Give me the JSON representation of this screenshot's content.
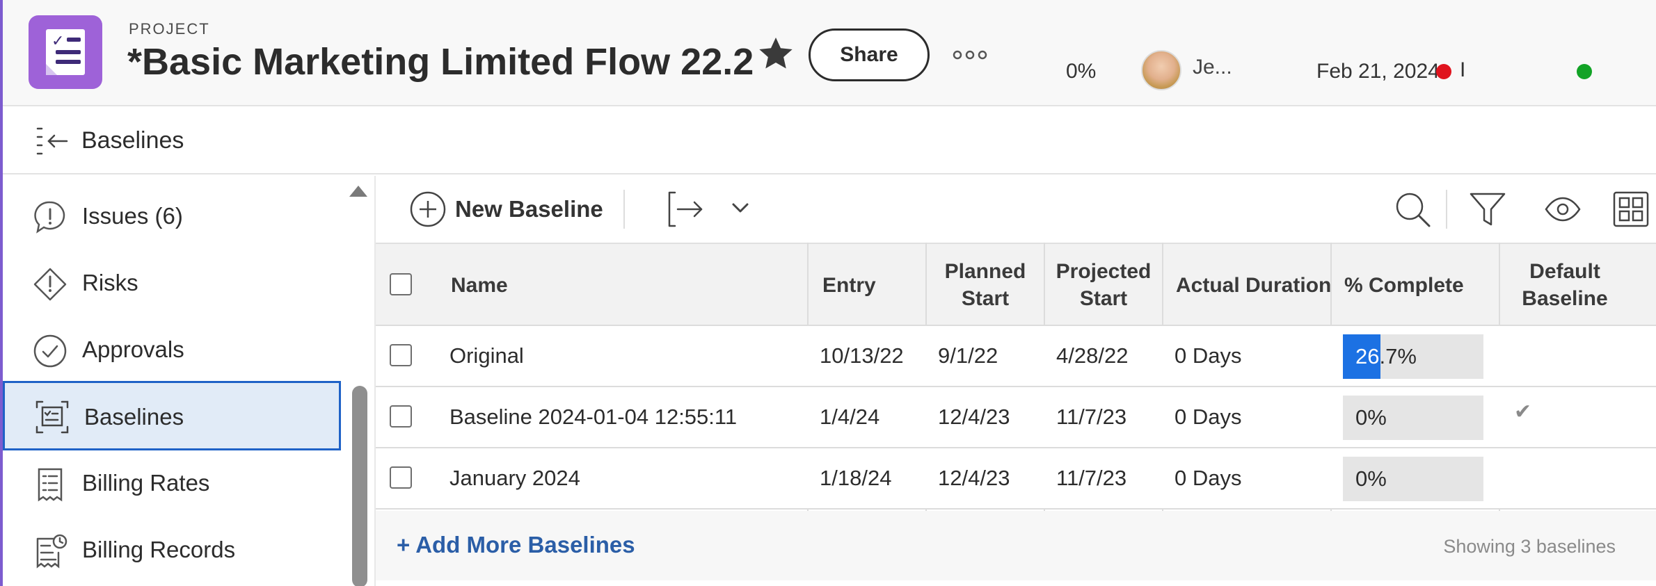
{
  "header": {
    "project_label": "PROJECT",
    "project_title": "*Basic Marketing Limited Flow 22.2",
    "share_label": "Share",
    "percent_complete": "0%",
    "owner_name": "Je...",
    "due_date": "Feb 21, 2024",
    "status_truncated": "I",
    "colors": {
      "icon_bg": "#9e62d8",
      "late_dot": "#e0141e",
      "ok_dot": "#12a326"
    }
  },
  "subheader": {
    "title": "Baselines"
  },
  "sidebar": {
    "items": [
      {
        "label": "Issues (6)",
        "icon": "issues-icon"
      },
      {
        "label": "Risks",
        "icon": "risks-icon"
      },
      {
        "label": "Approvals",
        "icon": "approvals-icon"
      },
      {
        "label": "Baselines",
        "icon": "baselines-icon",
        "active": true
      },
      {
        "label": "Billing Rates",
        "icon": "billing-rates-icon"
      },
      {
        "label": "Billing Records",
        "icon": "billing-records-icon"
      }
    ]
  },
  "toolbar": {
    "new_baseline_label": "New Baseline"
  },
  "table": {
    "columns": {
      "name": "Name",
      "entry": "Entry",
      "planned_start_1": "Planned",
      "planned_start_2": "Start",
      "projected_start_1": "Projected",
      "projected_start_2": "Start",
      "actual_duration": "Actual Duration",
      "percent_complete": "% Complete",
      "default_baseline_1": "Default",
      "default_baseline_2": "Baseline"
    },
    "rows": [
      {
        "name": "Original",
        "entry": "10/13/22",
        "planned_start": "9/1/22",
        "projected_start": "4/28/22",
        "actual_duration": "0 Days",
        "percent_complete": "26.7%",
        "percent_value": 26.7,
        "default": ""
      },
      {
        "name": "Baseline 2024-01-04 12:55:11",
        "entry": "1/4/24",
        "planned_start": "12/4/23",
        "projected_start": "11/7/23",
        "actual_duration": "0 Days",
        "percent_complete": "0%",
        "percent_value": 0,
        "default": "✔"
      },
      {
        "name": "January 2024",
        "entry": "1/18/24",
        "planned_start": "12/4/23",
        "projected_start": "11/7/23",
        "actual_duration": "0 Days",
        "percent_complete": "0%",
        "percent_value": 0,
        "default": ""
      }
    ],
    "add_more_label": "+ Add More Baselines",
    "showing_label": "Showing 3 baselines"
  }
}
